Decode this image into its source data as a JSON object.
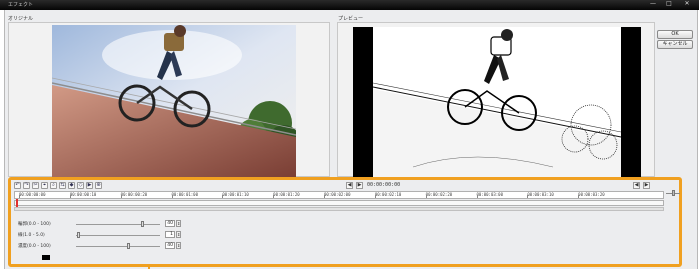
{
  "window": {
    "title": "エフェクト",
    "controls": [
      "—",
      "□",
      "✕"
    ]
  },
  "panels": {
    "original_label": "オリジナル",
    "preview_label": "プレビュー"
  },
  "buttons": {
    "ok": "OK",
    "cancel": "キャンセル"
  },
  "toolbar": {
    "tools": [
      "↶",
      "↷",
      "✂",
      "⌖",
      "⌕",
      "⇆",
      "◆",
      "◇",
      "▶",
      "⊕"
    ],
    "prev_label": "◀",
    "next_label": "▶",
    "end_prev_label": "◀",
    "end_next_label": "▶",
    "timecode": "00:00:00:00"
  },
  "timeline": {
    "ticks": [
      "00:00:00:00",
      "00:00:00:10",
      "00:00:00:20",
      "00:00:01:00",
      "00:00:01:10",
      "00:00:01:20",
      "00:00:02:00",
      "00:00:02:10",
      "00:00:02:20",
      "00:00:03:00",
      "00:00:03:10",
      "00:00:03:20"
    ]
  },
  "params": [
    {
      "label": "輪郭(0.0 - 100)",
      "value": "40",
      "slider": 0.78
    },
    {
      "label": "線(1.0 - 5.0)",
      "value": "1",
      "slider": 0.02
    },
    {
      "label": "濃度(0.0 - 100)",
      "value": "40",
      "slider": 0.62
    }
  ],
  "colors": {
    "accent": "#f0a020",
    "playhead": "#e03030",
    "line_color": "#000000"
  }
}
